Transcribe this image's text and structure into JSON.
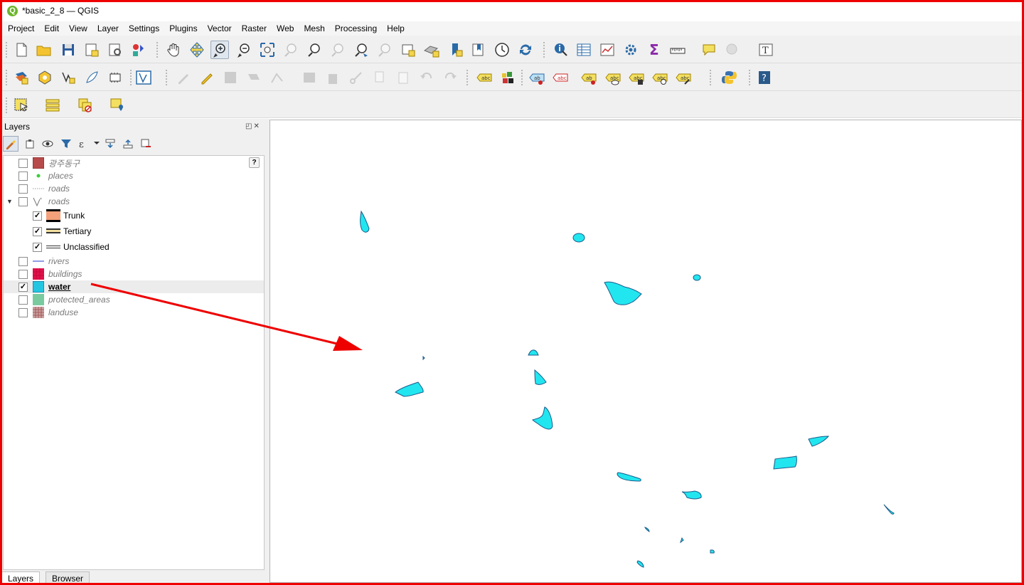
{
  "window": {
    "title": "*basic_2_8 — QGIS",
    "logo_letter": "Q"
  },
  "menu": [
    "Project",
    "Edit",
    "View",
    "Layer",
    "Settings",
    "Plugins",
    "Vector",
    "Raster",
    "Web",
    "Mesh",
    "Processing",
    "Help"
  ],
  "layers_panel": {
    "title": "Layers",
    "controls": "◰✕",
    "help": "?",
    "layers": [
      {
        "name": "광주동구",
        "checked": false,
        "symbol": "fill-brown"
      },
      {
        "name": "places",
        "checked": false,
        "symbol": "point-green"
      },
      {
        "name": "roads",
        "checked": false,
        "symbol": "line-dotted"
      },
      {
        "name": "roads",
        "checked": false,
        "symbol": "vector-icon",
        "expanded": true
      },
      {
        "name": "Trunk",
        "checked": true,
        "symbol": "line-trunk",
        "child": true
      },
      {
        "name": "Tertiary",
        "checked": true,
        "symbol": "line-tertiary",
        "child": true
      },
      {
        "name": "Unclassified",
        "checked": true,
        "symbol": "line-unclassified",
        "child": true
      },
      {
        "name": "rivers",
        "checked": false,
        "symbol": "line-blue"
      },
      {
        "name": "buildings",
        "checked": false,
        "symbol": "fill-crimson"
      },
      {
        "name": "water",
        "checked": true,
        "symbol": "fill-cyan",
        "selected": true
      },
      {
        "name": "protected_areas",
        "checked": false,
        "symbol": "fill-green"
      },
      {
        "name": "landuse",
        "checked": false,
        "symbol": "fill-hatch"
      }
    ],
    "tabs": [
      "Layers",
      "Browser"
    ]
  },
  "colors": {
    "water": "#22e6ef",
    "water_stroke": "#1a5a8a",
    "annotation": "#ee0000",
    "frame": "#ee0000"
  }
}
